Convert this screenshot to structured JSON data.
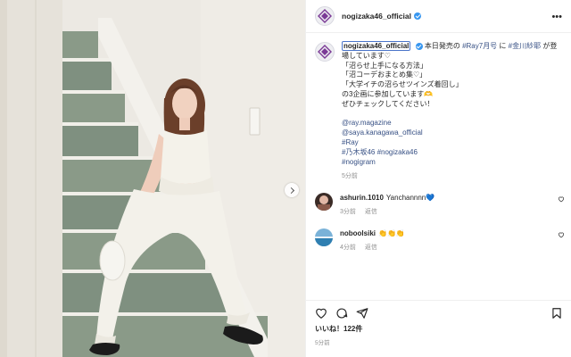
{
  "post": {
    "username": "nogizaka46_official",
    "caption": {
      "username": "nogizaka46_official",
      "line1_text": "本日発売の",
      "line1_tag1": "#Ray7月号",
      "line1_mid": "に",
      "line1_tag2": "#金川紗耶",
      "line1_end": "が登",
      "line2": "場しています♡",
      "line3": "「沼らせ上手になる方法」",
      "line4": "「沼コーデおまとめ集♡」",
      "line5": "「大学イチの沼らせツインズ着回し」",
      "line6": "の3企画に参加しています🫶",
      "line7": "ぜひチェックしてください！",
      "tags": [
        "@ray.magazine",
        "@saya.kanagawa_official",
        "#Ray",
        "#乃木坂46 #nogizaka46",
        "#nogigram"
      ],
      "time": "5分前"
    },
    "comments": [
      {
        "user": "ashurin.1010",
        "text": "Yanchannnn💙",
        "time": "3分前",
        "reply": "返信"
      },
      {
        "user": "noboolsiki",
        "text": "👏👏👏",
        "time": "4分前",
        "reply": "返信"
      }
    ],
    "likes": "いいね！122件",
    "ago": "5分前"
  }
}
